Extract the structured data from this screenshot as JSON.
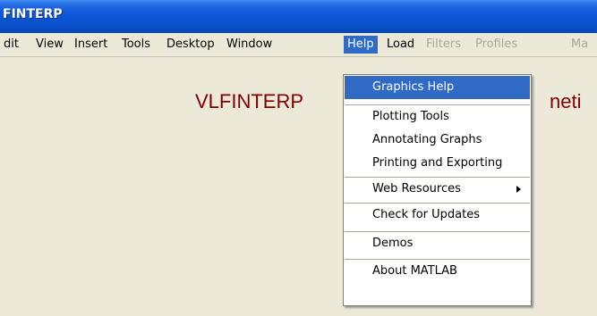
{
  "window": {
    "title": "FINTERP"
  },
  "menubar": {
    "items": [
      {
        "label": "dit",
        "state": "normal"
      },
      {
        "label": "View",
        "state": "normal"
      },
      {
        "label": "Insert",
        "state": "normal"
      },
      {
        "label": "Tools",
        "state": "normal"
      },
      {
        "label": "Desktop",
        "state": "normal"
      },
      {
        "label": "Window",
        "state": "normal"
      },
      {
        "label": "Help",
        "state": "active"
      },
      {
        "label": "Load",
        "state": "normal"
      },
      {
        "label": "Filters",
        "state": "disabled"
      },
      {
        "label": "Profiles",
        "state": "disabled"
      },
      {
        "label": "Ma",
        "state": "disabled"
      }
    ]
  },
  "content": {
    "heading": "VLFINTERP",
    "heading_tail": "neti"
  },
  "help_menu": {
    "items": [
      {
        "label": "Graphics Help",
        "highlighted": true
      },
      {
        "label": "Plotting Tools"
      },
      {
        "label": "Annotating Graphs"
      },
      {
        "label": "Printing and Exporting"
      },
      {
        "label": "Web Resources",
        "has_submenu": true
      },
      {
        "label": "Check for Updates"
      },
      {
        "label": "Demos"
      },
      {
        "label": "About MATLAB"
      }
    ]
  },
  "colors": {
    "titlebar": "#0a56d6",
    "menu_highlight": "#316ac5",
    "heading": "#800000",
    "disabled_text": "#aca899"
  }
}
